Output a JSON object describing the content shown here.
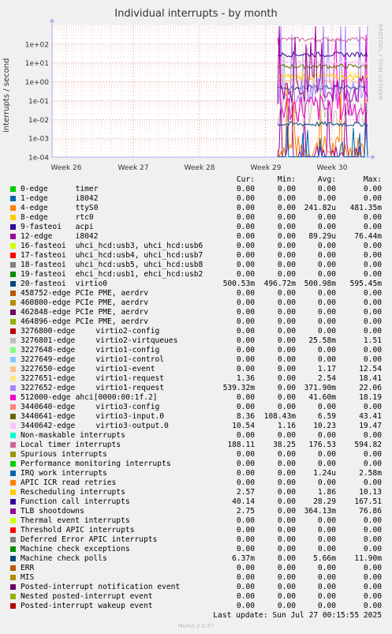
{
  "title": "Individual interrupts - by month",
  "side_brand": "RRDTOOL / TOBI OETIKER",
  "munin_version": "Munin 2.0.57",
  "last_update": "Last update: Sun Jul 27 00:15:55 2025",
  "legend_header": {
    "cur": "Cur:",
    "min": "Min:",
    "avg": "Avg:",
    "max": "Max:"
  },
  "chart_data": {
    "type": "line",
    "title": "Individual interrupts - by month",
    "ylabel": "interrupts / second",
    "yscale": "log",
    "ylim": [
      0.0001,
      1000
    ],
    "y_ticks": [
      "1e+02",
      "1e+01",
      "1e+00",
      "1e-01",
      "1e-02",
      "1e-03",
      "1e-04"
    ],
    "x_ticks": [
      "Week 26",
      "Week 27",
      "Week 28",
      "Week 29",
      "Week 30"
    ],
    "grid": true,
    "legend_position": "below",
    "data_region": "last ~1.4 weeks (Week 29 – Week 30); no data earlier",
    "series": [
      {
        "name": "0-edge",
        "desc": "timer",
        "color": "#00cc00",
        "cur": "0.00",
        "min": "0.00",
        "avg": "0.00",
        "max": "0.00"
      },
      {
        "name": "1-edge",
        "desc": "i8042",
        "color": "#0066b3",
        "cur": "0.00",
        "min": "0.00",
        "avg": "0.00",
        "max": "0.00"
      },
      {
        "name": "4-edge",
        "desc": "ttyS0",
        "color": "#ff8000",
        "cur": "0.00",
        "min": "0.00",
        "avg": "241.82u",
        "max": "481.35m"
      },
      {
        "name": "8-edge",
        "desc": "rtc0",
        "color": "#ffcc00",
        "cur": "0.00",
        "min": "0.00",
        "avg": "0.00",
        "max": "0.00"
      },
      {
        "name": "9-fasteoi",
        "desc": "acpi",
        "color": "#330099",
        "cur": "0.00",
        "min": "0.00",
        "avg": "0.00",
        "max": "0.00"
      },
      {
        "name": "12-edge",
        "desc": "i8042",
        "color": "#990099",
        "cur": "0.00",
        "min": "0.00",
        "avg": "89.29u",
        "max": "76.44m"
      },
      {
        "name": "16-fasteoi",
        "desc": "uhci_hcd:usb3, uhci_hcd:usb6",
        "color": "#ccff00",
        "cur": "0.00",
        "min": "0.00",
        "avg": "0.00",
        "max": "0.00"
      },
      {
        "name": "17-fasteoi",
        "desc": "uhci_hcd:usb4, uhci_hcd:usb7",
        "color": "#ff0000",
        "cur": "0.00",
        "min": "0.00",
        "avg": "0.00",
        "max": "0.00"
      },
      {
        "name": "18-fasteoi",
        "desc": "uhci_hcd:usb5, uhci_hcd:usb8",
        "color": "#808080",
        "cur": "0.00",
        "min": "0.00",
        "avg": "0.00",
        "max": "0.00"
      },
      {
        "name": "19-fasteoi",
        "desc": "ehci_hcd:usb1, ehci_hcd:usb2",
        "color": "#008f00",
        "cur": "0.00",
        "min": "0.00",
        "avg": "0.00",
        "max": "0.00"
      },
      {
        "name": "20-fasteoi",
        "desc": "virtio0",
        "color": "#00487d",
        "cur": "500.53m",
        "min": "496.72m",
        "avg": "500.98m",
        "max": "595.45m"
      },
      {
        "name": "458752-edge",
        "desc": "PCIe PME, aerdrv",
        "color": "#b35a00",
        "cur": "0.00",
        "min": "0.00",
        "avg": "0.00",
        "max": "0.00"
      },
      {
        "name": "460800-edge",
        "desc": "PCIe PME, aerdrv",
        "color": "#b38f00",
        "cur": "0.00",
        "min": "0.00",
        "avg": "0.00",
        "max": "0.00"
      },
      {
        "name": "462848-edge",
        "desc": "PCIe PME, aerdrv",
        "color": "#6b006b",
        "cur": "0.00",
        "min": "0.00",
        "avg": "0.00",
        "max": "0.00"
      },
      {
        "name": "464896-edge",
        "desc": "PCIe PME, aerdrv",
        "color": "#8fb300",
        "cur": "0.00",
        "min": "0.00",
        "avg": "0.00",
        "max": "0.00"
      },
      {
        "name": "3276800-edge",
        "desc": "virtio2-config",
        "color": "#b30000",
        "cur": "0.00",
        "min": "0.00",
        "avg": "0.00",
        "max": "0.00"
      },
      {
        "name": "3276801-edge",
        "desc": "virtio2-virtqueues",
        "color": "#bebebe",
        "cur": "0.00",
        "min": "0.00",
        "avg": "25.58m",
        "max": "1.51"
      },
      {
        "name": "3227648-edge",
        "desc": "virtio1-config",
        "color": "#80ff80",
        "cur": "0.00",
        "min": "0.00",
        "avg": "0.00",
        "max": "0.00"
      },
      {
        "name": "3227649-edge",
        "desc": "virtio1-control",
        "color": "#80c9ff",
        "cur": "0.00",
        "min": "0.00",
        "avg": "0.00",
        "max": "0.00"
      },
      {
        "name": "3227650-edge",
        "desc": "virtio1-event",
        "color": "#ffc080",
        "cur": "0.00",
        "min": "0.00",
        "avg": "1.17",
        "max": "12.54"
      },
      {
        "name": "3227651-edge",
        "desc": "virtio1-request",
        "color": "#ffe680",
        "cur": "1.36",
        "min": "0.00",
        "avg": "2.54",
        "max": "18.41"
      },
      {
        "name": "3227652-edge",
        "desc": "virtio1-request",
        "color": "#aa80ff",
        "cur": "539.32m",
        "min": "0.00",
        "avg": "371.90m",
        "max": "22.06"
      },
      {
        "name": "512000-edge",
        "desc": "ahci[0000:00:1f.2]",
        "color": "#ee00cc",
        "cur": "0.00",
        "min": "0.00",
        "avg": "41.60m",
        "max": "18.19"
      },
      {
        "name": "3440640-edge",
        "desc": "virtio3-config",
        "color": "#ff8080",
        "cur": "0.00",
        "min": "0.00",
        "avg": "0.00",
        "max": "0.00"
      },
      {
        "name": "3440641-edge",
        "desc": "virtio3-input.0",
        "color": "#666600",
        "cur": "8.36",
        "min": "108.43m",
        "avg": "6.59",
        "max": "43.41"
      },
      {
        "name": "3440642-edge",
        "desc": "virtio3-output.0",
        "color": "#ffbfff",
        "cur": "10.54",
        "min": "1.16",
        "avg": "10.23",
        "max": "19.47"
      },
      {
        "name": "Non-maskable interrupts",
        "desc": "",
        "color": "#00ffcc",
        "cur": "0.00",
        "min": "0.00",
        "avg": "0.00",
        "max": "0.00"
      },
      {
        "name": "Local timer interrupts",
        "desc": "",
        "color": "#cc6699",
        "cur": "188.11",
        "min": "38.25",
        "avg": "176.53",
        "max": "594.82"
      },
      {
        "name": "Spurious interrupts",
        "desc": "",
        "color": "#999900",
        "cur": "0.00",
        "min": "0.00",
        "avg": "0.00",
        "max": "0.00"
      },
      {
        "name": "Performance monitoring interrupts",
        "desc": "",
        "color": "#00cc00",
        "cur": "0.00",
        "min": "0.00",
        "avg": "0.00",
        "max": "0.00"
      },
      {
        "name": "IRQ work interrupts",
        "desc": "",
        "color": "#0066b3",
        "cur": "0.00",
        "min": "0.00",
        "avg": "1.24u",
        "max": "2.58m"
      },
      {
        "name": "APIC ICR read retries",
        "desc": "",
        "color": "#ff8000",
        "cur": "0.00",
        "min": "0.00",
        "avg": "0.00",
        "max": "0.00"
      },
      {
        "name": "Rescheduling interrupts",
        "desc": "",
        "color": "#ffcc00",
        "cur": "2.57",
        "min": "0.00",
        "avg": "1.86",
        "max": "10.13"
      },
      {
        "name": "Function call interrupts",
        "desc": "",
        "color": "#330099",
        "cur": "40.14",
        "min": "0.00",
        "avg": "28.29",
        "max": "167.51"
      },
      {
        "name": "TLB shootdowns",
        "desc": "",
        "color": "#990099",
        "cur": "2.75",
        "min": "0.00",
        "avg": "364.13m",
        "max": "76.86"
      },
      {
        "name": "Thermal event interrupts",
        "desc": "",
        "color": "#ccff00",
        "cur": "0.00",
        "min": "0.00",
        "avg": "0.00",
        "max": "0.00"
      },
      {
        "name": "Threshold APIC interrupts",
        "desc": "",
        "color": "#ff0000",
        "cur": "0.00",
        "min": "0.00",
        "avg": "0.00",
        "max": "0.00"
      },
      {
        "name": "Deferred Error APIC interrupts",
        "desc": "",
        "color": "#808080",
        "cur": "0.00",
        "min": "0.00",
        "avg": "0.00",
        "max": "0.00"
      },
      {
        "name": "Machine check exceptions",
        "desc": "",
        "color": "#008f00",
        "cur": "0.00",
        "min": "0.00",
        "avg": "0.00",
        "max": "0.00"
      },
      {
        "name": "Machine check polls",
        "desc": "",
        "color": "#00487d",
        "cur": "6.37m",
        "min": "0.00",
        "avg": "5.66m",
        "max": "11.90m"
      },
      {
        "name": "ERR",
        "desc": "",
        "color": "#b35a00",
        "cur": "0.00",
        "min": "0.00",
        "avg": "0.00",
        "max": "0.00"
      },
      {
        "name": "MIS",
        "desc": "",
        "color": "#b38f00",
        "cur": "0.00",
        "min": "0.00",
        "avg": "0.00",
        "max": "0.00"
      },
      {
        "name": "Posted-interrupt notification event",
        "desc": "",
        "color": "#6b006b",
        "cur": "0.00",
        "min": "0.00",
        "avg": "0.00",
        "max": "0.00"
      },
      {
        "name": "Nested posted-interrupt event",
        "desc": "",
        "color": "#8fb300",
        "cur": "0.00",
        "min": "0.00",
        "avg": "0.00",
        "max": "0.00"
      },
      {
        "name": "Posted-interrupt wakeup event",
        "desc": "",
        "color": "#b30000",
        "cur": "0.00",
        "min": "0.00",
        "avg": "0.00",
        "max": "0.00"
      }
    ]
  }
}
